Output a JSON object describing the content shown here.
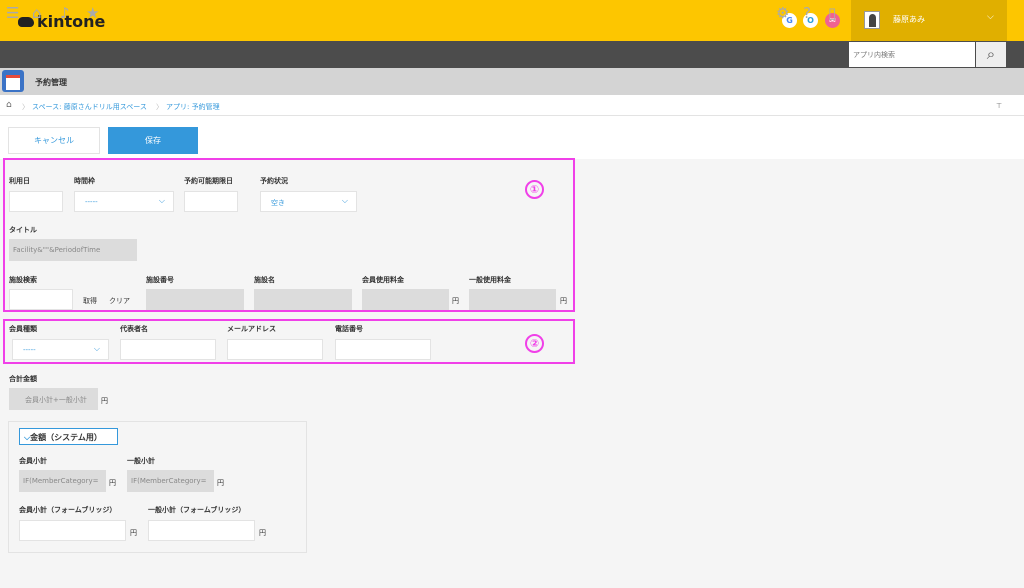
{
  "header": {
    "logo": "kintone",
    "icons": [
      "G",
      "O",
      "✉"
    ],
    "user": "藤原あみ"
  },
  "nav": {
    "search_placeholder": "アプリ内検索"
  },
  "app": {
    "title": "予約管理"
  },
  "breadcrumb": {
    "space": "スペース: 藤原さんドリル用スペース",
    "app": "アプリ: 予約管理"
  },
  "toolbar": {
    "cancel": "キャンセル",
    "save": "保存"
  },
  "form": {
    "use_date": "利用日",
    "time_slot": "時間枠",
    "time_slot_value": "-----",
    "deadline": "予約可能期限日",
    "status": "予約状況",
    "status_value": "空き",
    "title_label": "タイトル",
    "title_value": "Facility&\"\"&PeriodofTime",
    "facility_search": "施設検索",
    "fetch": "取得",
    "clear": "クリア",
    "facility_no": "施設番号",
    "facility_name": "施設名",
    "member_fee": "会員使用料金",
    "general_fee": "一般使用料金",
    "yen": "円",
    "member_type": "会員種類",
    "member_type_value": "-----",
    "rep_name": "代表者名",
    "email": "メールアドレス",
    "phone": "電話番号",
    "total": "合計金額",
    "total_value": "会員小計+一般小計",
    "group_label": "金額（システム用）",
    "member_sub": "会員小計",
    "member_sub_value": "IF(MemberCategory=",
    "general_sub": "一般小計",
    "general_sub_value": "IF(MemberCategory=",
    "member_sub_fb": "会員小計（フォームブリッジ）",
    "general_sub_fb": "一般小計（フォームブリッジ）"
  },
  "markers": [
    "①",
    "②"
  ],
  "colors": {
    "header": "#fdc600",
    "nav": "#4c4c4c",
    "accent": "#3498db",
    "marker": "#f040e8"
  }
}
